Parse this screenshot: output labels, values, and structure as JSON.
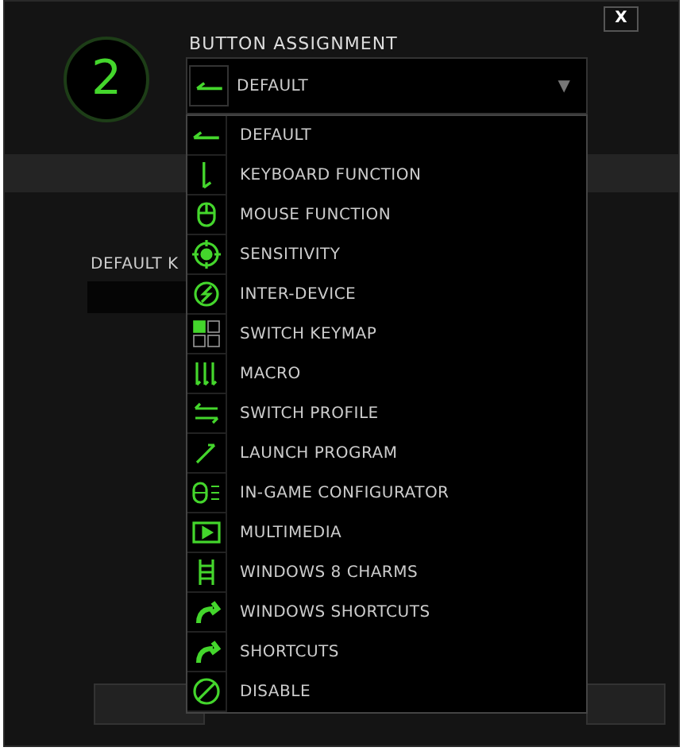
{
  "close_button": "X",
  "slot_number": "2",
  "assignment": {
    "label": "BUTTON ASSIGNMENT",
    "value": "DEFAULT",
    "arrow": "▼"
  },
  "menu": [
    {
      "label": "DEFAULT"
    },
    {
      "label": "KEYBOARD FUNCTION"
    },
    {
      "label": "MOUSE FUNCTION"
    },
    {
      "label": "SENSITIVITY"
    },
    {
      "label": "INTER-DEVICE"
    },
    {
      "label": "SWITCH KEYMAP"
    },
    {
      "label": "MACRO"
    },
    {
      "label": "SWITCH PROFILE"
    },
    {
      "label": "LAUNCH PROGRAM"
    },
    {
      "label": "IN-GAME CONFIGURATOR"
    },
    {
      "label": "MULTIMEDIA"
    },
    {
      "label": "WINDOWS 8 CHARMS"
    },
    {
      "label": "WINDOWS SHORTCUTS"
    },
    {
      "label": "SHORTCUTS"
    },
    {
      "label": "DISABLE"
    }
  ],
  "background_label": "DEFAULT K"
}
